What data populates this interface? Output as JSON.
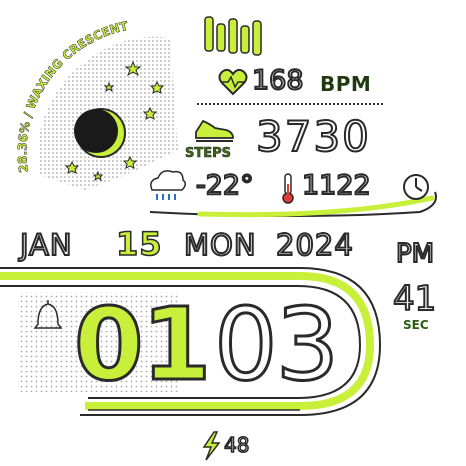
{
  "moon": {
    "phase_text": "28.36% / WAXING CRESCENT"
  },
  "health": {
    "heart_rate": "168",
    "heart_rate_unit": "BPM",
    "steps_label": "STEPS",
    "steps": "3730"
  },
  "weather": {
    "temperature": "-22°",
    "altitude": "1122"
  },
  "date": {
    "month": "JAN",
    "day": "15",
    "weekday": "MON",
    "year": "2024"
  },
  "time": {
    "ampm": "PM",
    "hours": "01",
    "minutes": "03",
    "seconds": "41",
    "sec_label": "SEC"
  },
  "battery": {
    "level": "48"
  },
  "colors": {
    "accent": "#c8f03a",
    "outline": "#2a2a2a"
  }
}
